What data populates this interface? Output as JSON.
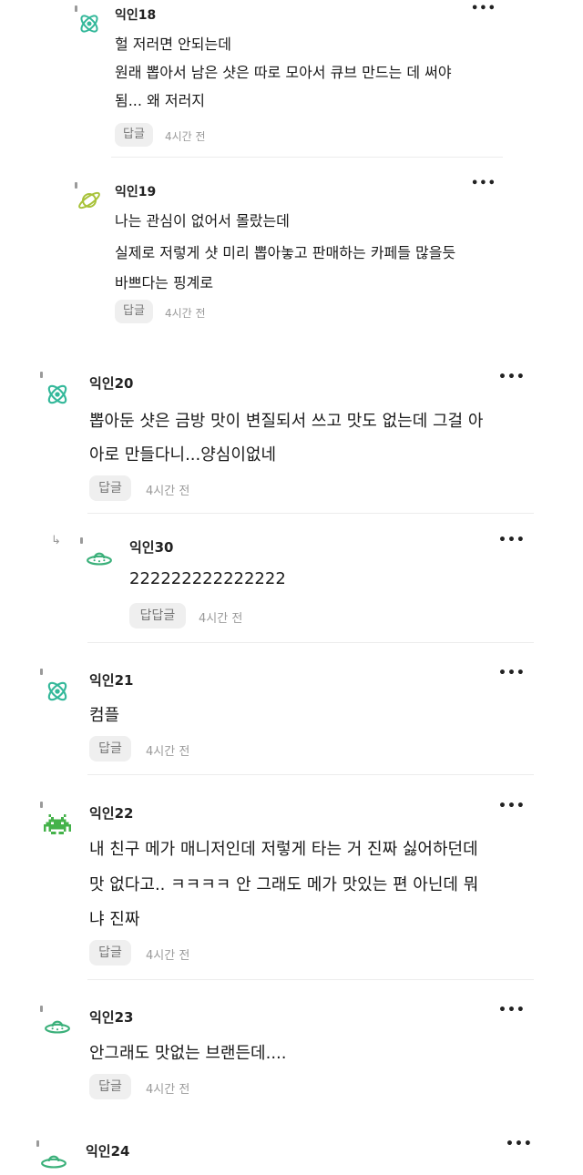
{
  "comments": [
    {
      "name": "익인18",
      "lines": [
        "헐 저러면 안되는데",
        "원래 뽑아서 남은 샷은 따로 모아서 큐브 만드는 데 써야",
        "됨... 왜 저러지"
      ],
      "reply_label": "답글",
      "time": "4시간 전",
      "avatar_icon": "atom-icon",
      "avatar_color": "#34b89a"
    },
    {
      "name": "익인19",
      "lines": [
        "나는 관심이 없어서 몰랐는데",
        "실제로 저렇게 샷 미리 뽑아놓고 판매하는 카페들 많을듯",
        "바쁘다는 핑계로"
      ],
      "reply_label": "답글",
      "time": "4시간 전",
      "avatar_icon": "planet-icon",
      "avatar_color": "#a8c23a"
    },
    {
      "name": "익인20",
      "lines": [
        "뽑아둔 샷은 금방 맛이 변질되서 쓰고 맛도 없는데 그걸 아",
        "아로 만들다니...양심이없네"
      ],
      "reply_label": "답글",
      "time": "4시간 전",
      "avatar_icon": "atom-icon",
      "avatar_color": "#34b89a"
    },
    {
      "name": "익인30",
      "lines": [
        "222222222222222"
      ],
      "reply_label": "답답글",
      "time": "4시간 전",
      "avatar_icon": "ufo-icon",
      "avatar_color": "#3bb07a"
    },
    {
      "name": "익인21",
      "lines": [
        "컴플"
      ],
      "reply_label": "답글",
      "time": "4시간 전",
      "avatar_icon": "atom-icon",
      "avatar_color": "#34b89a"
    },
    {
      "name": "익인22",
      "lines": [
        "내 친구 메가 매니저인데 저렇게 타는 거 진짜 싫어하던데",
        "맛 없다고.. ㅋㅋㅋㅋ 안 그래도 메가 맛있는 편 아닌데 뭐",
        "냐 진짜"
      ],
      "reply_label": "답글",
      "time": "4시간 전",
      "avatar_icon": "space-invader-icon",
      "avatar_color": "#44b24a"
    },
    {
      "name": "익인23",
      "lines": [
        "안그래도 맛없는 브랜든데...."
      ],
      "reply_label": "답글",
      "time": "4시간 전",
      "avatar_icon": "ufo-icon",
      "avatar_color": "#3bb07a"
    },
    {
      "name": "익인24",
      "lines": [],
      "reply_label": "",
      "time": "",
      "avatar_icon": "ufo-icon",
      "avatar_color": "#3bb07a"
    }
  ],
  "more_label": "•••"
}
